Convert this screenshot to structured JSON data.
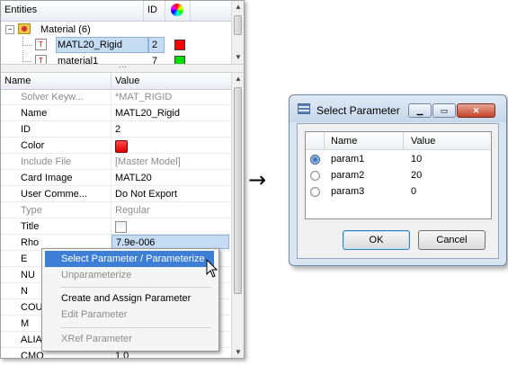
{
  "entities_panel": {
    "col_entities": "Entities",
    "col_id": "ID",
    "tree": {
      "group_label": "Material (6)",
      "items": [
        {
          "label": "MATL20_Rigid",
          "id": "2",
          "color": "#ff0000",
          "selected": true
        },
        {
          "label": "material1",
          "id": "7",
          "color": "#00e000",
          "selected": false
        }
      ]
    }
  },
  "properties": {
    "col_name": "Name",
    "col_value": "Value",
    "rows": [
      {
        "name": "Solver Keyw...",
        "value": "*MAT_RIGID",
        "disabled": true
      },
      {
        "name": "Name",
        "value": "MATL20_Rigid",
        "disabled": false
      },
      {
        "name": "ID",
        "value": "2",
        "disabled": false
      },
      {
        "name": "Color",
        "value": "",
        "disabled": false
      },
      {
        "name": "Include File",
        "value": "[Master Model]",
        "disabled": true
      },
      {
        "name": "Card Image",
        "value": "MATL20",
        "disabled": false
      },
      {
        "name": "User Comme...",
        "value": "Do Not Export",
        "disabled": false
      },
      {
        "name": "Type",
        "value": "Regular",
        "disabled": true
      },
      {
        "name": "Title",
        "value": "",
        "disabled": false
      },
      {
        "name": "Rho",
        "value": "7.9e-006",
        "disabled": false
      },
      {
        "name": "E",
        "value": "",
        "disabled": false
      },
      {
        "name": "NU",
        "value": "",
        "disabled": false
      },
      {
        "name": "N",
        "value": "",
        "disabled": false
      },
      {
        "name": "COU",
        "value": "",
        "disabled": false
      },
      {
        "name": "M",
        "value": "",
        "disabled": false
      },
      {
        "name": "ALIA",
        "value": "",
        "disabled": false
      },
      {
        "name": "CMO",
        "value": "1.0",
        "disabled": false
      }
    ],
    "color_value": "#e00000"
  },
  "context_menu": {
    "items": [
      {
        "label": "Select Parameter / Parameterize",
        "disabled": false,
        "highlighted": true
      },
      {
        "label": "Unparameterize",
        "disabled": true
      },
      {
        "label": "Create and Assign Parameter",
        "disabled": false
      },
      {
        "label": "Edit Parameter",
        "disabled": true
      },
      {
        "label": "XRef Parameter",
        "disabled": true
      }
    ]
  },
  "arrow": "→",
  "dialog": {
    "title": "Select Parameter",
    "col_name": "Name",
    "col_value": "Value",
    "params": [
      {
        "name": "param1",
        "value": "10",
        "selected": true
      },
      {
        "name": "param2",
        "value": "20",
        "selected": false
      },
      {
        "name": "param3",
        "value": "0",
        "selected": false
      }
    ],
    "ok_label": "OK",
    "cancel_label": "Cancel"
  }
}
